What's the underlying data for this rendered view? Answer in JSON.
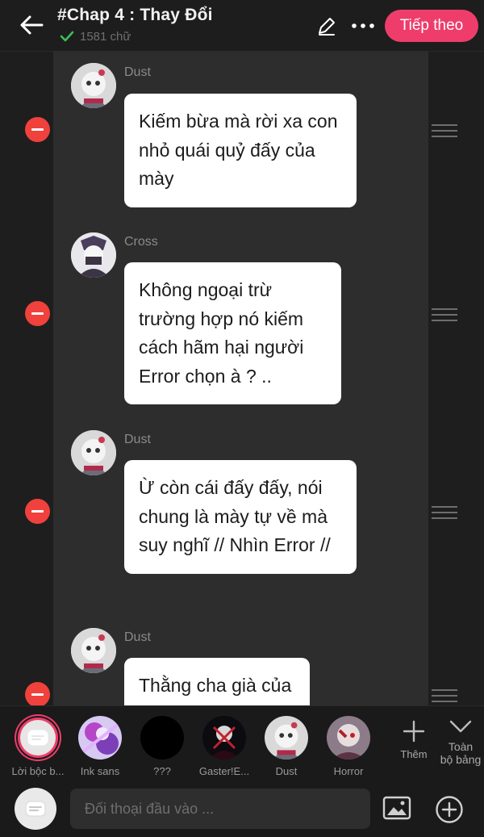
{
  "header": {
    "title": "#Chap 4 : Thay Đổi",
    "word_count": "1581 chữ",
    "next_label": "Tiếp theo"
  },
  "messages": [
    {
      "name": "Dust",
      "text": "Kiếm bừa mà rời xa con nhỏ quái quỷ đấy của mày"
    },
    {
      "name": "Cross",
      "text": "Không ngoại trừ trường hợp nó kiếm cách hãm hại người Error chọn à ? .."
    },
    {
      "name": "Dust",
      "text": "Ừ còn cái đấy đấy, nói chung là mày tự về mà suy nghĩ // Nhìn Error //"
    },
    {
      "name": "Dust",
      "text": "Thằng cha già của"
    }
  ],
  "characters": [
    {
      "label": "Lời bộc b..."
    },
    {
      "label": "Ink sans"
    },
    {
      "label": "???"
    },
    {
      "label": "Gaster!E..."
    },
    {
      "label": "Dust"
    },
    {
      "label": "Horror"
    }
  ],
  "tools": {
    "add_label": "Thêm",
    "all_label_1": "Toàn",
    "all_label_2": "bộ bảng"
  },
  "input": {
    "placeholder": "Đối thoại đầu vào ..."
  },
  "colors": {
    "accent": "#ee3d6b",
    "delete": "#f0413d",
    "bubble": "#ffffff",
    "background": "#1e1e1e"
  }
}
